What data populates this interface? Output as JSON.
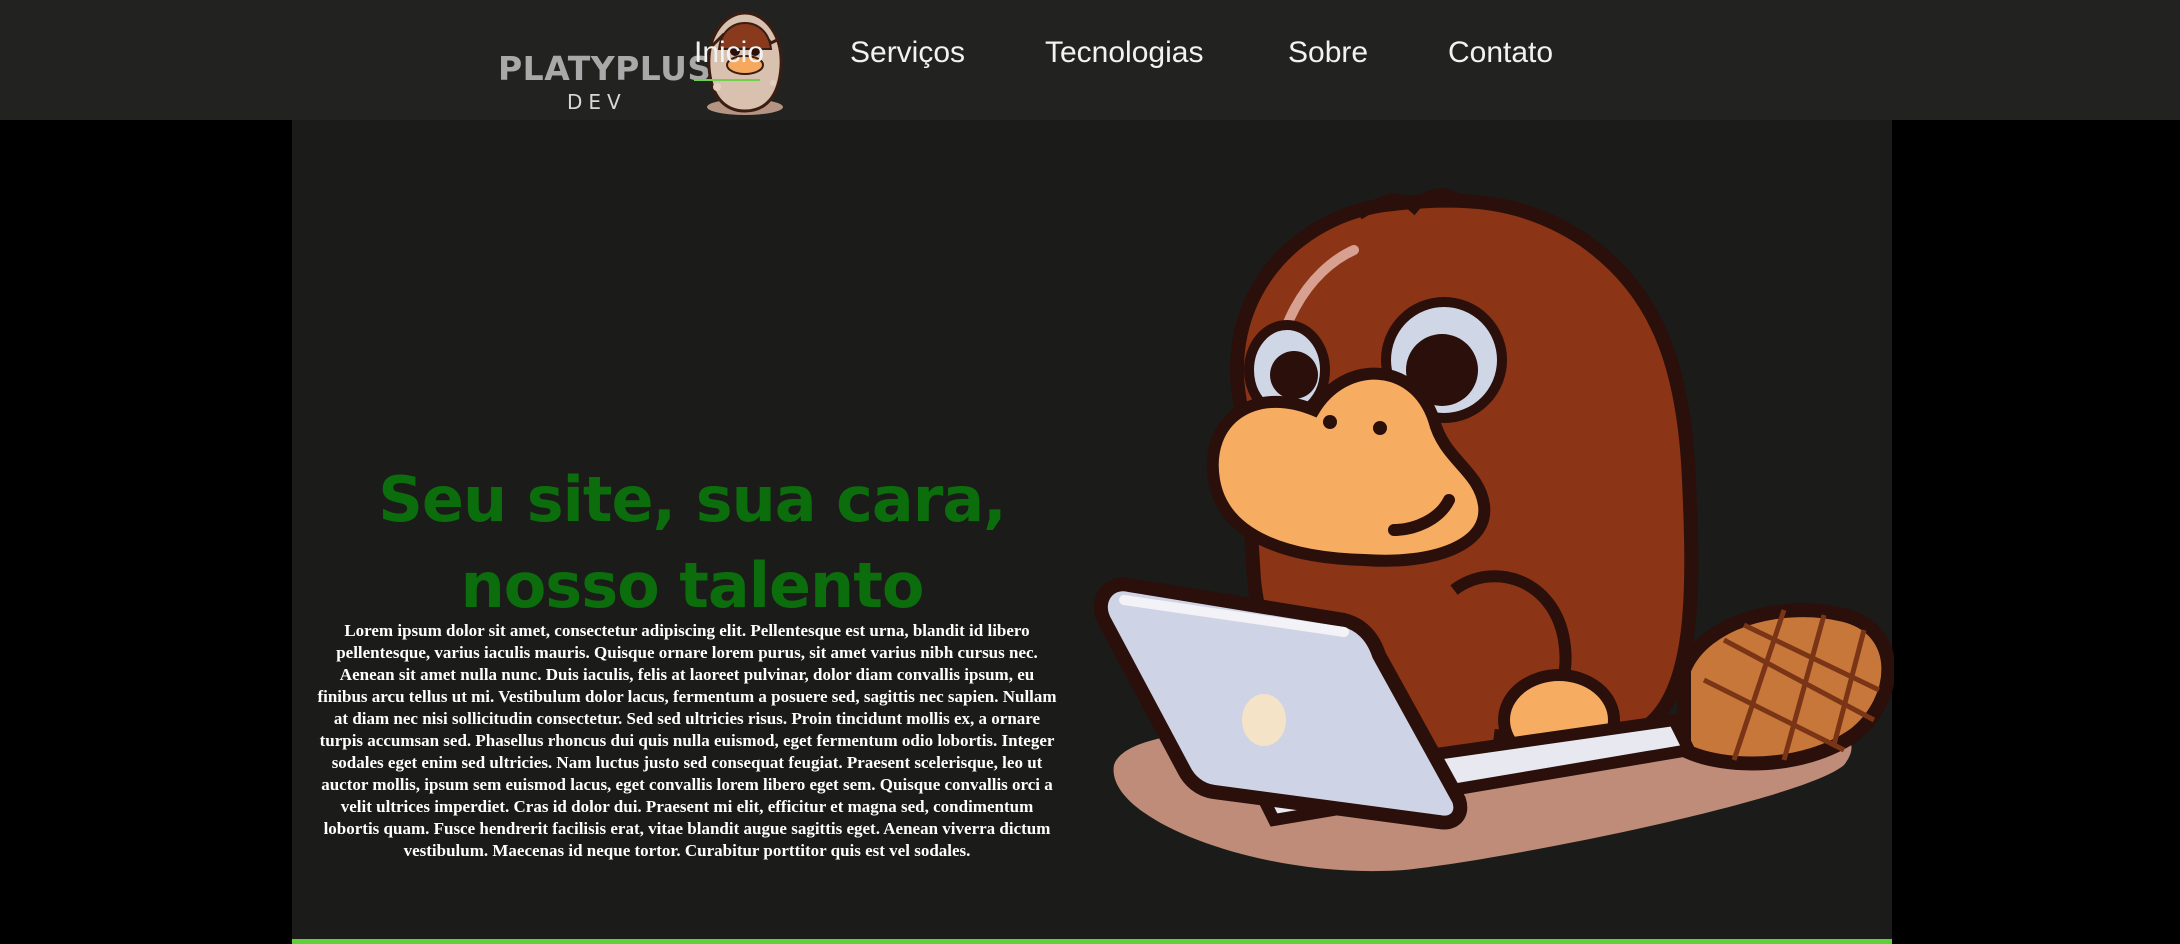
{
  "logo": {
    "wordmark": "PLATYPLUS",
    "subtext": "DEV"
  },
  "nav": {
    "items": [
      {
        "label": "Inicio"
      },
      {
        "label": "Serviços"
      },
      {
        "label": "Tecnologias"
      },
      {
        "label": "Sobre"
      },
      {
        "label": "Contato"
      }
    ]
  },
  "hero": {
    "headline_line1": "Seu site, sua cara,",
    "headline_line2": "nosso talento",
    "body": "Lorem ipsum dolor sit amet, consectetur adipiscing elit. Pellentesque est urna, blandit id libero pellentesque, varius iaculis mauris. Quisque ornare lorem purus, sit amet varius nibh cursus nec. Aenean sit amet nulla nunc. Duis iaculis, felis at laoreet pulvinar, dolor diam convallis ipsum, eu finibus arcu tellus ut mi. Vestibulum dolor lacus, fermentum a posuere sed, sagittis nec sapien. Nullam at diam nec nisi sollicitudin consectetur. Sed sed ultricies risus. Proin tincidunt mollis ex, a ornare turpis accumsan sed. Phasellus rhoncus dui quis nulla euismod, eget fermentum odio lobortis. Integer sodales eget enim sed ultricies. Nam luctus justo sed consequat feugiat. Praesent scelerisque, leo ut auctor mollis, ipsum sem euismod lacus, eget convallis lorem libero eget sem. Quisque convallis orci a velit ultrices imperdiet. Cras id dolor dui. Praesent mi elit, efficitur et magna sed, condimentum lobortis quam. Fusce hendrerit facilisis erat, vitae blandit augue sagittis eget. Aenean viverra dictum vestibulum. Maecenas id neque tortor. Curabitur porttitor quis est vel sodales."
  },
  "icons": {
    "logo_mascot": "platypus-egg-icon",
    "hero_mascot": "platypus-laptop-illustration"
  },
  "colors": {
    "topbar": "#222321",
    "hero_bg": "#1b1c1a",
    "headline": "#0c6d0c",
    "accent": "#5fd03a"
  }
}
